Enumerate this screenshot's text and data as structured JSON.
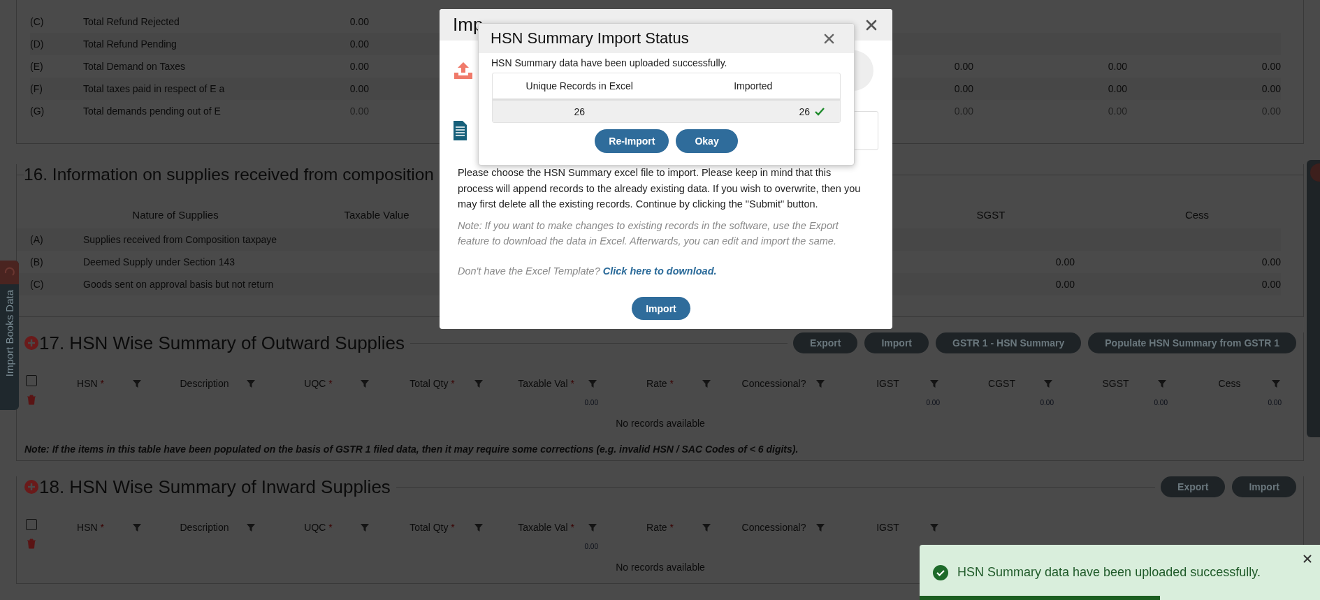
{
  "refund_summary": {
    "rows": [
      {
        "code": "(C)",
        "description": "Total Refund Rejected",
        "amounts": [
          "0.00"
        ],
        "disabled": false
      },
      {
        "code": "(D)",
        "description": "Total Refund Pending",
        "amounts": [
          "0.00"
        ],
        "disabled": false
      },
      {
        "code": "(E)",
        "description": "Total Demand on Taxes",
        "amounts": [
          "0.00",
          "0.00",
          "0.00",
          "0.00"
        ],
        "disabled": false
      },
      {
        "code": "(F)",
        "description": "Total taxes paid in respect of E a",
        "amounts": [
          "0.00",
          "0.00",
          "0.00",
          "0.00"
        ],
        "disabled": false
      },
      {
        "code": "(G)",
        "description": "Total demands pending out of E",
        "amounts": [
          "0.00",
          "0.00",
          "0.00",
          "0.00"
        ],
        "disabled": true
      }
    ]
  },
  "composition_supplies": {
    "title": "16. Information on supplies received from composition",
    "columns": [
      "Nature of Supplies",
      "Taxable Value",
      "SGST",
      "Cess"
    ],
    "rows": [
      {
        "code": "(A)",
        "description": "Supplies received from Composition taxpaye"
      },
      {
        "code": "(B)",
        "description": "Deemed Supply under Section 143",
        "amounts": [
          "0.00",
          "0.00"
        ]
      },
      {
        "code": "(C)",
        "description": "Goods sent on approval basis but not return",
        "amounts": [
          "0.00",
          "0.00"
        ]
      }
    ]
  },
  "outward_hsn": {
    "title": "17. HSN Wise Summary of Outward Supplies",
    "buttons": [
      "Export",
      "Import",
      "GSTR 1 - HSN Summary",
      "Populate HSN Summary from GSTR 1"
    ],
    "select_all_checked": false,
    "columns": [
      {
        "label": "HSN",
        "mark": "*"
      },
      {
        "label": "Description"
      },
      {
        "label": "UQC",
        "mark": "*"
      },
      {
        "label": "Total Qty",
        "mark": "*"
      },
      {
        "label": "Taxable Val",
        "mark": "*",
        "total": "0.00"
      },
      {
        "label": "Rate",
        "mark": "*"
      },
      {
        "label": "Concessional?"
      },
      {
        "label": "IGST",
        "total": "0.00"
      },
      {
        "label": "CGST",
        "total": "0.00"
      },
      {
        "label": "SGST",
        "total": "0.00"
      },
      {
        "label": "Cess",
        "total": "0.00"
      }
    ],
    "empty_text": "No records available",
    "note": "Note: If the items in this table have been populated on the basis of GSTR 1 filed data, then it may require some corrections (e.g. invalid HSN / SAC Codes of < 6 digits)."
  },
  "inward_hsn": {
    "title": "18. HSN Wise Summary of Inward Supplies",
    "buttons": [
      "Export",
      "Import"
    ],
    "select_all_checked": false,
    "columns": [
      {
        "label": "HSN",
        "mark": "*"
      },
      {
        "label": "Description"
      },
      {
        "label": "UQC",
        "mark": "*"
      },
      {
        "label": "Total Qty",
        "mark": "*"
      },
      {
        "label": "Taxable Val",
        "mark": "*",
        "total": "0.00"
      },
      {
        "label": "Rate",
        "mark": "*"
      },
      {
        "label": "Concessional?"
      },
      {
        "label": "IGST"
      }
    ],
    "empty_text": "No records available"
  },
  "import_books_tab": {
    "label": "Import Books Data"
  },
  "import_dialog": {
    "title": "Imp",
    "instructions": "Please choose the HSN Summary excel file to import. Please keep in mind that this process will append records to the already existing data. If you wish to overwrite, then you may first delete all the existing records. Continue by clicking the \"Submit\" button.",
    "note": "Note: If you want to make changes to existing records in the software, use the Export feature to download the data in Excel. Afterwards, you can edit and import the same.",
    "template_prompt": "Don't have the Excel Template?",
    "template_link": "Click here to download.",
    "import_button": "Import"
  },
  "status_dialog": {
    "title": "HSN Summary Import Status",
    "message": "HSN Summary data have been uploaded successfully.",
    "columns": [
      "Unique Records in Excel",
      "Imported"
    ],
    "cells": [
      "26",
      "26"
    ],
    "imported_ok": true,
    "buttons": [
      "Re-Import",
      "Okay"
    ]
  },
  "toast": {
    "message": "HSN Summary data have been uploaded successfully.",
    "level": 0.6
  }
}
